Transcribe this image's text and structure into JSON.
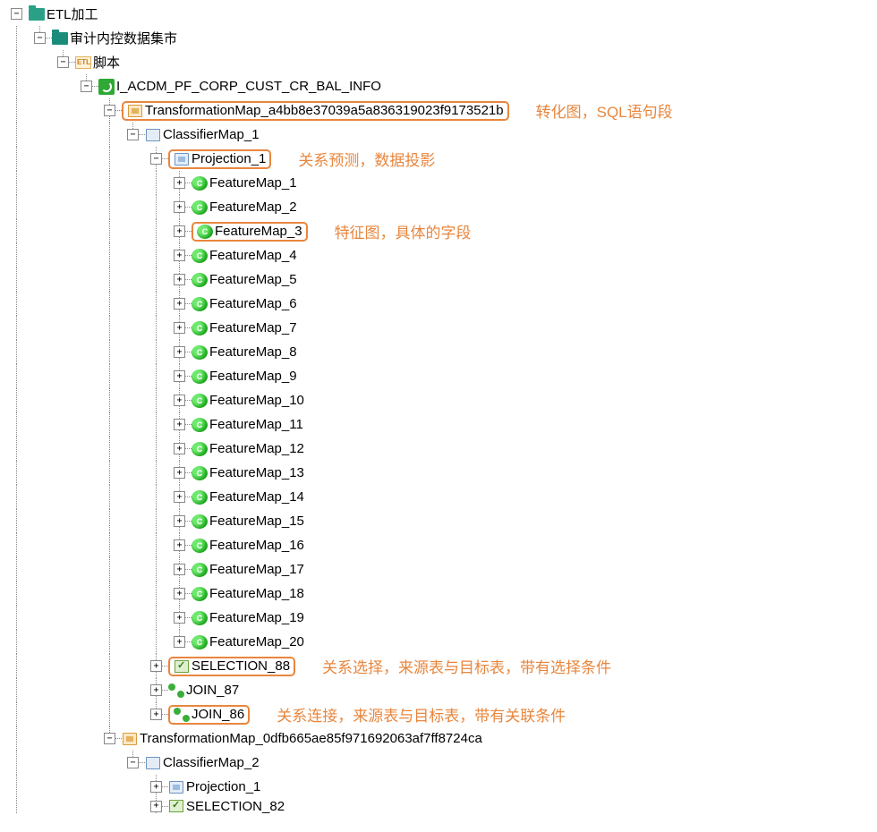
{
  "tree": {
    "root": {
      "label": "ETL加工"
    },
    "l1": {
      "label": "审计内控数据集市"
    },
    "l2": {
      "label": "脚本"
    },
    "l3": {
      "label": "I_ACDM_PF_CORP_CUST_CR_BAL_INFO"
    },
    "tmap1": {
      "label": "TransformationMap_a4bb8e37039a5a836319023f9173521b"
    },
    "cmap1": {
      "label": "ClassifierMap_1"
    },
    "proj1": {
      "label": "Projection_1"
    },
    "feature_maps": [
      "FeatureMap_1",
      "FeatureMap_2",
      "FeatureMap_3",
      "FeatureMap_4",
      "FeatureMap_5",
      "FeatureMap_6",
      "FeatureMap_7",
      "FeatureMap_8",
      "FeatureMap_9",
      "FeatureMap_10",
      "FeatureMap_11",
      "FeatureMap_12",
      "FeatureMap_13",
      "FeatureMap_14",
      "FeatureMap_15",
      "FeatureMap_16",
      "FeatureMap_17",
      "FeatureMap_18",
      "FeatureMap_19",
      "FeatureMap_20"
    ],
    "sel88": {
      "label": "SELECTION_88"
    },
    "join87": {
      "label": "JOIN_87"
    },
    "join86": {
      "label": "JOIN_86"
    },
    "tmap2": {
      "label": "TransformationMap_0dfb665ae85f971692063af7ff8724ca"
    },
    "cmap2": {
      "label": "ClassifierMap_2"
    },
    "proj2": {
      "label": "Projection_1"
    },
    "sel82": {
      "label": "SELECTION_82"
    }
  },
  "notes": {
    "tmap": "转化图，SQL语句段",
    "proj": "关系预测，数据投影",
    "feat": "特征图，具体的字段",
    "sel": "关系选择，来源表与目标表，带有选择条件",
    "join": "关系连接，来源表与目标表，带有关联条件"
  },
  "glyph": {
    "plus": "+",
    "minus": "−",
    "c": "C",
    "etl": "ETL"
  }
}
